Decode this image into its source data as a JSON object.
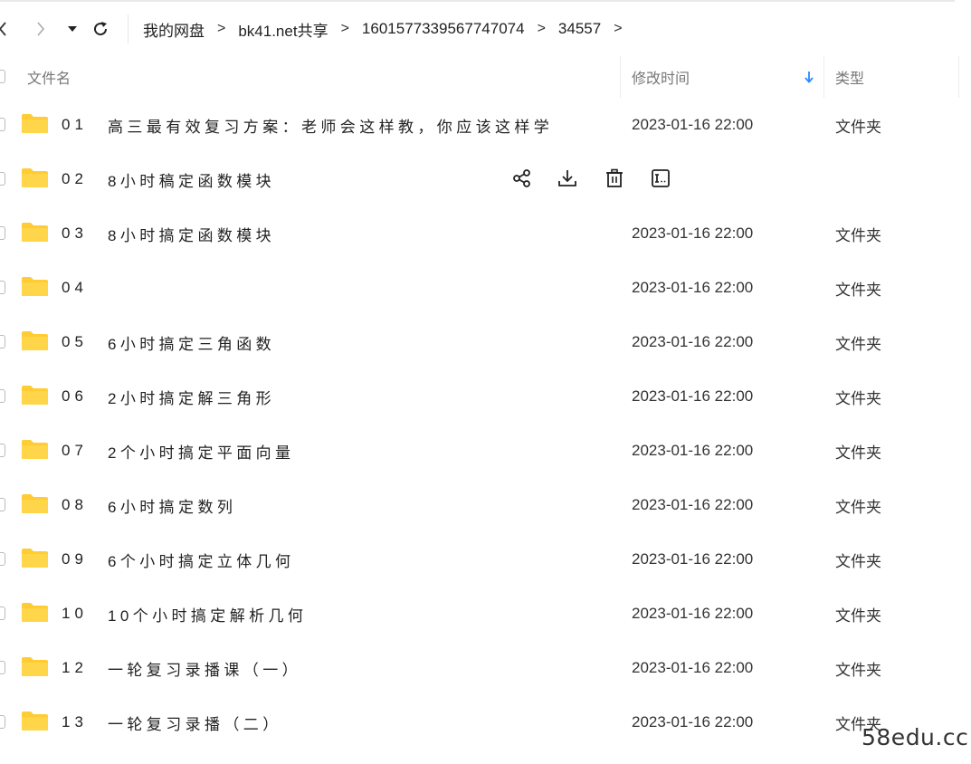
{
  "toolbar": {
    "back_icon": "chevron-left-icon",
    "forward_icon": "chevron-right-icon",
    "history_icon": "caret-down-icon",
    "refresh_icon": "refresh-icon",
    "breadcrumb": [
      "我的网盘",
      "bk41.net共享",
      "1601577339567747074",
      "34557"
    ],
    "separator": ">"
  },
  "header": {
    "name": "文件名",
    "modified": "修改时间",
    "sort_icon": "arrow-down-icon",
    "type": "类型"
  },
  "colors": {
    "folder": "#FFCC33",
    "sort_arrow": "#2b88ff"
  },
  "files": [
    {
      "num": "01",
      "title": "高三最有效复习方案：老师会这样教，你应该这样学",
      "date": "2023-01-16 22:00",
      "type": "文件夹"
    },
    {
      "num": "02",
      "title": "8小时稿定函数模块",
      "date": "",
      "type": "",
      "hovered": true,
      "actions": [
        "share-icon",
        "download-icon",
        "delete-icon",
        "rename-icon"
      ]
    },
    {
      "num": "03",
      "title": "8小时搞定函数模块",
      "date": "2023-01-16 22:00",
      "type": "文件夹"
    },
    {
      "num": "04",
      "title": "",
      "date": "2023-01-16 22:00",
      "type": "文件夹"
    },
    {
      "num": "05",
      "title": "6小时搞定三角函数",
      "date": "2023-01-16 22:00",
      "type": "文件夹"
    },
    {
      "num": "06",
      "title": "2小时搞定解三角形",
      "date": "2023-01-16 22:00",
      "type": "文件夹"
    },
    {
      "num": "07",
      "title": "2个小时搞定平面向量",
      "date": "2023-01-16 22:00",
      "type": "文件夹"
    },
    {
      "num": "08",
      "title": "6小时搞定数列",
      "date": "2023-01-16 22:00",
      "type": "文件夹"
    },
    {
      "num": "09",
      "title": "6个小时搞定立体几何",
      "date": "2023-01-16 22:00",
      "type": "文件夹"
    },
    {
      "num": "10",
      "title": "10个小时搞定解析几何",
      "date": "2023-01-16 22:00",
      "type": "文件夹"
    },
    {
      "num": "12",
      "title": "一轮复习录播课（一）",
      "date": "2023-01-16 22:00",
      "type": "文件夹"
    },
    {
      "num": "13",
      "title": "一轮复习录播（二）",
      "date": "2023-01-16 22:00",
      "type": "文件夹"
    }
  ],
  "watermark": "58edu.cc"
}
